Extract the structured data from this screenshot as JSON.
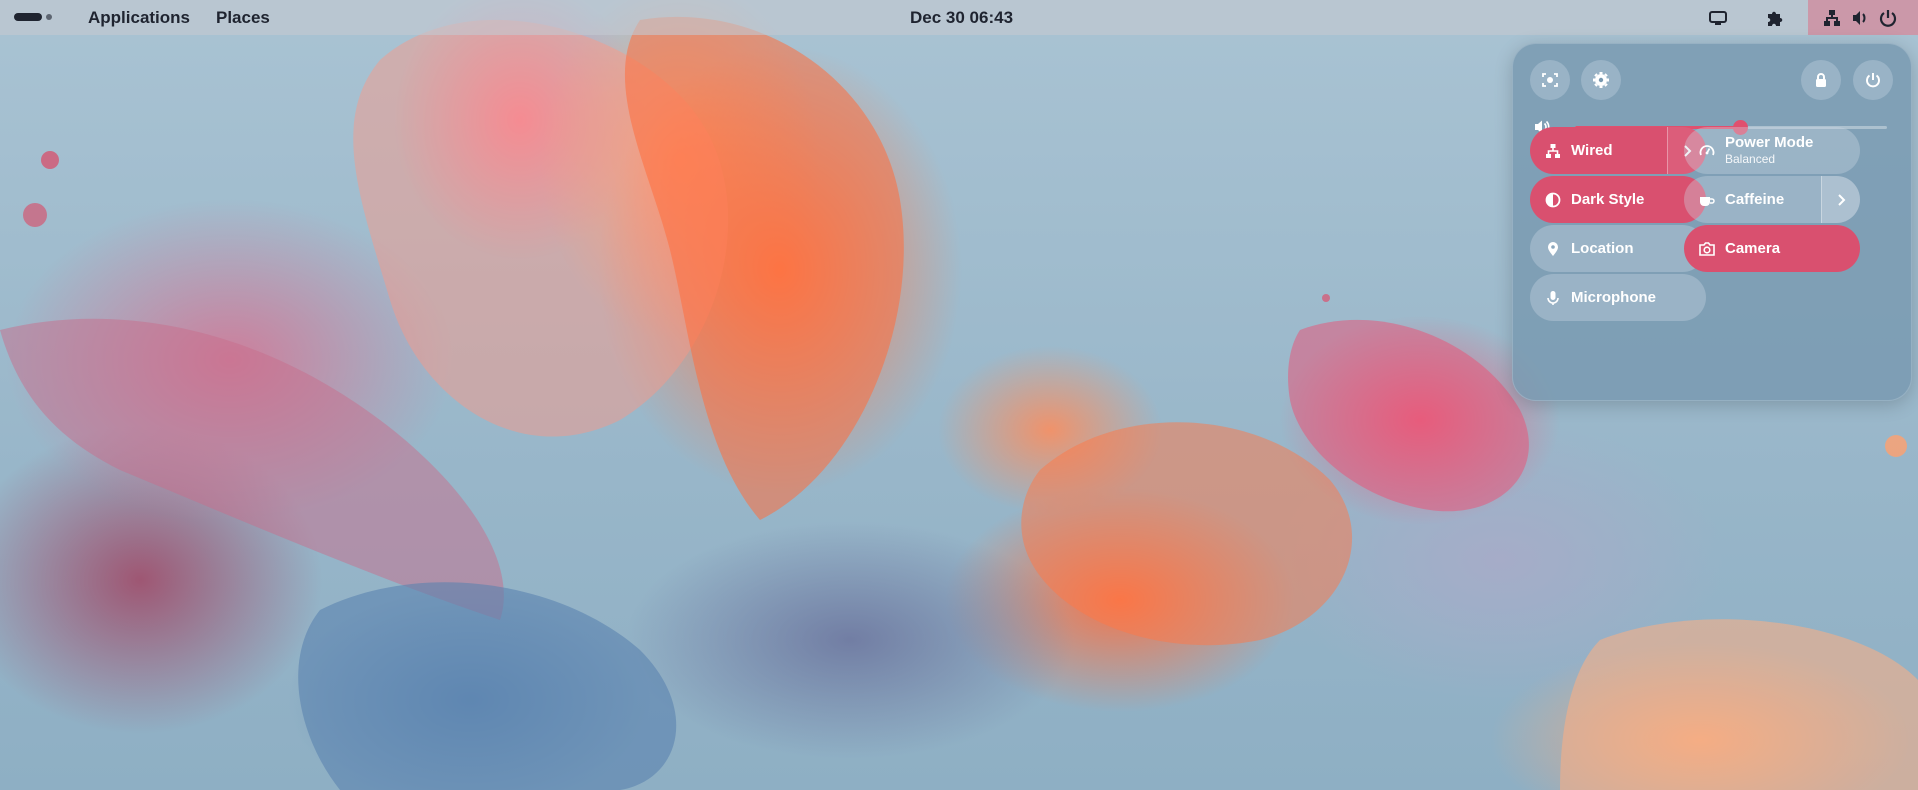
{
  "topbar": {
    "menu": [
      "Applications",
      "Places"
    ],
    "clock": "Dec 30  06:43",
    "icons": [
      "activities-indicator-icon",
      "screen-share-icon",
      "extensions-puzzle-icon",
      "network-wired-icon",
      "volume-icon",
      "power-icon"
    ]
  },
  "quick_settings": {
    "buttons": [
      "screenshot-icon",
      "settings-gear-icon",
      "lock-icon",
      "power-icon"
    ],
    "volume_level": 0.53,
    "tiles": [
      {
        "label": "Wired",
        "sublabel": "",
        "active": true,
        "has_menu": true,
        "icon": "network-wired-icon"
      },
      {
        "label": "Power Mode",
        "sublabel": "Balanced",
        "active": false,
        "has_menu": false,
        "icon": "power-mode-icon"
      },
      {
        "label": "Dark Style",
        "sublabel": "",
        "active": true,
        "has_menu": false,
        "icon": "dark-style-icon"
      },
      {
        "label": "Caffeine",
        "sublabel": "",
        "active": false,
        "has_menu": true,
        "icon": "caffeine-cup-icon"
      },
      {
        "label": "Location",
        "sublabel": "",
        "active": false,
        "has_menu": false,
        "icon": "location-pin-icon"
      },
      {
        "label": "Camera",
        "sublabel": "",
        "active": true,
        "has_menu": false,
        "icon": "camera-icon"
      },
      {
        "label": "Microphone",
        "sublabel": "",
        "active": false,
        "has_menu": false,
        "icon": "microphone-icon"
      }
    ]
  },
  "colors": {
    "accent": "#d9506f",
    "panel": "#7898b0",
    "topbar_text": "#1f2430"
  }
}
